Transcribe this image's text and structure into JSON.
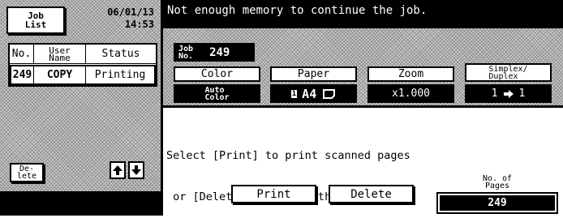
{
  "header": {
    "job_list_line1": "Job",
    "job_list_line2": "List",
    "date": "06/01/13",
    "time": "14:53",
    "message": "Not enough memory to continue the job."
  },
  "job_table": {
    "col_no": "No.",
    "col_user_line1": "User",
    "col_user_line2": "Name",
    "col_status": "Status",
    "rows": [
      {
        "no": "249",
        "user": "COPY",
        "status": "Printing"
      }
    ],
    "delete_line1": "De-",
    "delete_line2": "lete"
  },
  "job_info": {
    "job_no_line1": "Job",
    "job_no_line2": "No.",
    "job_no": "249",
    "color_label": "Color",
    "color_value_line1": "Auto",
    "color_value_line2": "Color",
    "paper_label": "Paper",
    "paper_tray": "1",
    "paper_value": "A4",
    "zoom_label": "Zoom",
    "zoom_value": "x1.000",
    "simplex_line1": "Simplex/",
    "simplex_line2": "Duplex",
    "simplex_from": "1",
    "simplex_to": "1"
  },
  "dialog": {
    "line1": "Select [Print] to print scanned pages",
    "line2": " or [Delete] to cancel the job.",
    "print_label": "Print",
    "delete_label": "Delete",
    "pages_line1": "No. of",
    "pages_line2": "Pages",
    "pages_value": "249"
  },
  "icons": {
    "up": "arrow-up-icon",
    "down": "arrow-down-icon",
    "orientation": "paper-landscape-icon",
    "arrow": "right-arrow-icon"
  }
}
